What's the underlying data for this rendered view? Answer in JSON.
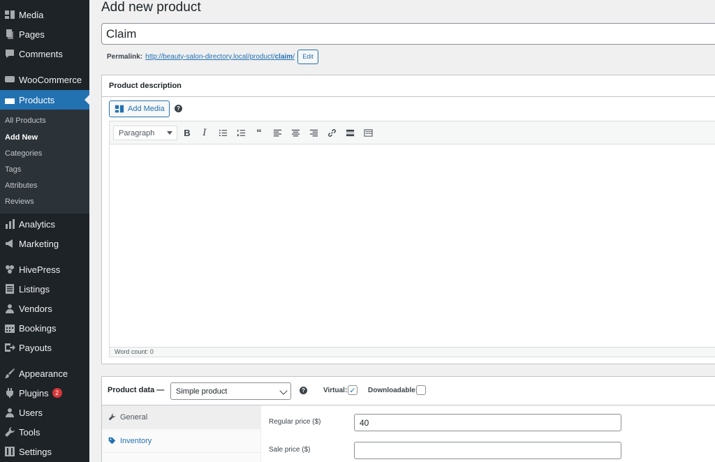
{
  "sidebar": {
    "items": [
      {
        "label": "Media",
        "icon": "media-icon",
        "current": false
      },
      {
        "label": "Pages",
        "icon": "pages-icon",
        "current": false
      },
      {
        "label": "Comments",
        "icon": "comments-icon",
        "current": false
      },
      {
        "label": "WooCommerce",
        "icon": "woocommerce-icon",
        "current": false
      },
      {
        "label": "Products",
        "icon": "products-icon",
        "current": true
      },
      {
        "label": "Analytics",
        "icon": "analytics-icon",
        "current": false
      },
      {
        "label": "Marketing",
        "icon": "megaphone-icon",
        "current": false
      },
      {
        "label": "HivePress",
        "icon": "hivepress-icon",
        "current": false
      },
      {
        "label": "Listings",
        "icon": "listings-icon",
        "current": false
      },
      {
        "label": "Vendors",
        "icon": "vendors-icon",
        "current": false
      },
      {
        "label": "Bookings",
        "icon": "calendar-icon",
        "current": false
      },
      {
        "label": "Payouts",
        "icon": "payouts-icon",
        "current": false
      },
      {
        "label": "Appearance",
        "icon": "brush-icon",
        "current": false
      },
      {
        "label": "Plugins",
        "icon": "plugin-icon",
        "current": false,
        "badge": "2"
      },
      {
        "label": "Users",
        "icon": "users-icon",
        "current": false
      },
      {
        "label": "Tools",
        "icon": "wrench-icon",
        "current": false
      },
      {
        "label": "Settings",
        "icon": "settings-icon",
        "current": false
      }
    ],
    "submenu": [
      {
        "label": "All Products",
        "current": false
      },
      {
        "label": "Add New",
        "current": true
      },
      {
        "label": "Categories",
        "current": false
      },
      {
        "label": "Tags",
        "current": false
      },
      {
        "label": "Attributes",
        "current": false
      },
      {
        "label": "Reviews",
        "current": false
      }
    ]
  },
  "page": {
    "title": "Add new product",
    "product_title": "Claim",
    "permalink_label": "Permalink:",
    "permalink_base": "http://beauty-salon-directory.local/product/",
    "permalink_slug": "claim",
    "permalink_trailing": "/",
    "edit_label": "Edit"
  },
  "description": {
    "header": "Product description",
    "add_media_label": "Add Media",
    "format_value": "Paragraph",
    "word_count": "Word count: 0"
  },
  "product_data": {
    "label": "Product data —",
    "type_value": "Simple product",
    "virtual_label": "Virtual:",
    "virtual_checked": true,
    "downloadable_label": "Downloadable:",
    "downloadable_checked": false,
    "tabs": [
      {
        "label": "General",
        "icon": "wrench-icon",
        "active": true
      },
      {
        "label": "Inventory",
        "icon": "tag-icon",
        "active": false
      }
    ],
    "regular_price_label": "Regular price ($)",
    "regular_price_value": "40",
    "sale_price_label": "Sale price ($)",
    "sale_price_value": ""
  },
  "colors": {
    "sidebar_bg": "#1d2327",
    "accent": "#2271b1",
    "badge": "#d63638"
  }
}
